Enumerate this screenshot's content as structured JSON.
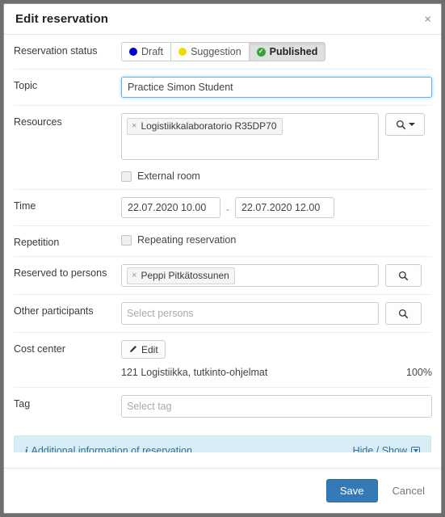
{
  "dialog": {
    "title": "Edit reservation",
    "close_label": "×"
  },
  "rows": {
    "status": {
      "label": "Reservation status",
      "options": [
        {
          "label": "Draft",
          "color": "#0000cc",
          "marker": "dot",
          "active": false
        },
        {
          "label": "Suggestion",
          "color": "#efdd00",
          "marker": "dot",
          "active": false
        },
        {
          "label": "Published",
          "color": "#35a435",
          "marker": "check",
          "active": true
        }
      ]
    },
    "topic": {
      "label": "Topic",
      "value": "Practice Simon Student"
    },
    "resources": {
      "label": "Resources",
      "tokens": [
        {
          "remove": "×",
          "text": "Logistiikkalaboratorio R35DP70"
        }
      ],
      "search_button": "search-dropdown",
      "external_room_label": "External room",
      "external_room_checked": false
    },
    "time": {
      "label": "Time",
      "start": "22.07.2020 10.00",
      "separator": "-",
      "end": "22.07.2020 12.00"
    },
    "repetition": {
      "label": "Repetition",
      "checkbox_label": "Repeating reservation",
      "checked": false
    },
    "reserved_to": {
      "label": "Reserved to persons",
      "tokens": [
        {
          "remove": "×",
          "text": "Peppi Pitkätossunen"
        }
      ]
    },
    "other_participants": {
      "label": "Other participants",
      "placeholder": "Select persons",
      "value": ""
    },
    "cost_center": {
      "label": "Cost center",
      "edit_button": "Edit",
      "entry_name": "121 Logistiikka, tutkinto-ohjelmat",
      "entry_percent": "100%"
    },
    "tag": {
      "label": "Tag",
      "placeholder": "Select tag",
      "value": ""
    }
  },
  "info_bar": {
    "text": "Additional information of reservation",
    "toggle_label": "Hide / Show"
  },
  "footer": {
    "save_label": "Save",
    "cancel_label": "Cancel"
  },
  "colors": {
    "accent": "#337ab7",
    "info_bg": "#d9edf7",
    "info_fg": "#31708f",
    "draft": "#0000cc",
    "suggestion": "#efdd00",
    "published": "#35a435"
  }
}
